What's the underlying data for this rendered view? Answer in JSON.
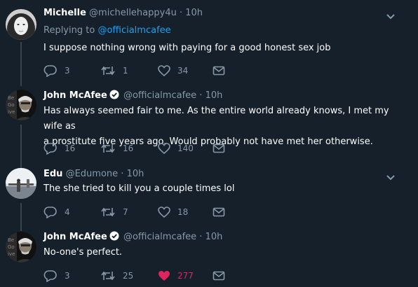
{
  "tweets": [
    {
      "name": "Michelle",
      "handle": "@michellehappy4u",
      "sep": "·",
      "time": "10h",
      "replying_prefix": "Replying to",
      "replying_handle": "@officialmcafee",
      "verified": false,
      "text": "I suppose nothing wrong with paying for a good honest sex job",
      "replies": "3",
      "retweets": "1",
      "likes": "34",
      "liked": false
    },
    {
      "name": "John McAfee",
      "handle": "@officialmcafee",
      "sep": "·",
      "time": "10h",
      "verified": true,
      "text_line1": "Has always seemed fair to me. As the entire world already knows, I met my wife as",
      "text_line2": "a prostitute five years ago. Would probably not have met her otherwise.",
      "replies": "16",
      "retweets": "16",
      "likes": "140",
      "liked": false
    },
    {
      "name": "Edu",
      "handle": "@Edumone",
      "sep": "·",
      "time": "10h",
      "verified": false,
      "text": "The she tried to kill you a couple times lol",
      "replies": "4",
      "retweets": "7",
      "likes": "18",
      "liked": false
    },
    {
      "name": "John McAfee",
      "handle": "@officialmcafee",
      "sep": "·",
      "time": "10h",
      "verified": true,
      "text": "No-one's perfect.",
      "replies": "3",
      "retweets": "25",
      "likes": "277",
      "liked": true
    }
  ],
  "icons": {
    "reply": "reply-icon",
    "retweet": "retweet-icon",
    "like": "heart-icon",
    "dm": "envelope-icon",
    "more": "chevron-down-icon",
    "verified": "verified-badge-icon"
  },
  "colors": {
    "background": "#15202b",
    "name": "#ffffff",
    "secondary": "#8899a6",
    "link": "#1da1f2",
    "liked": "#e0245e",
    "verified": "#ffffff",
    "thread_line": "#38444d"
  }
}
